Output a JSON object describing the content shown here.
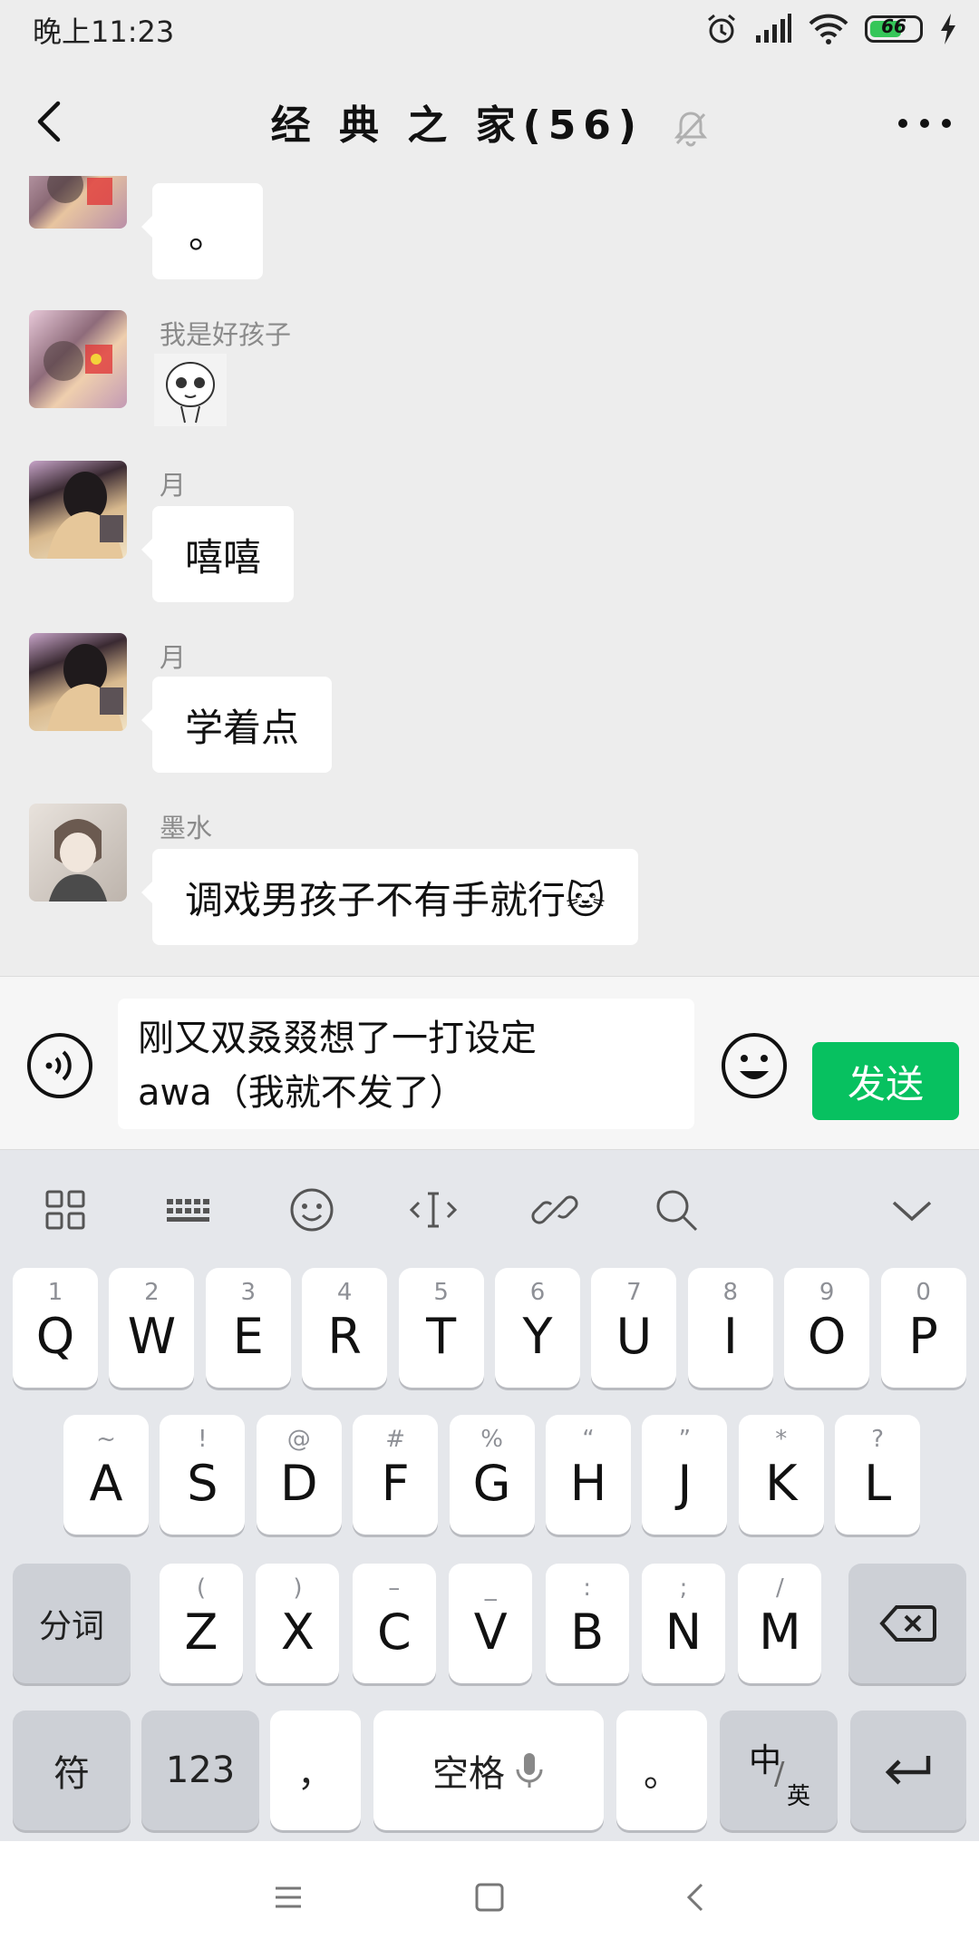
{
  "status_bar": {
    "time": "晚上11:23",
    "battery_level": "66",
    "battery_fraction": 0.66
  },
  "header": {
    "title": "经 典 之 家(56)"
  },
  "messages": [
    {
      "sender": "",
      "text": "。"
    },
    {
      "sender": "我是好孩子",
      "sticker": "face-sticker"
    },
    {
      "sender": "月",
      "text": "嘻嘻"
    },
    {
      "sender": "月",
      "text": "学着点"
    },
    {
      "sender": "墨水",
      "text": "调戏男孩子不有手就行🐱"
    }
  ],
  "composer": {
    "draft_line1": "刚又双叒叕想了一打设定",
    "draft_line2": "awa（我就不发了）",
    "send_label": "发送"
  },
  "keyboard": {
    "row1": [
      {
        "hint": "1",
        "key": "Q"
      },
      {
        "hint": "2",
        "key": "W"
      },
      {
        "hint": "3",
        "key": "E"
      },
      {
        "hint": "4",
        "key": "R"
      },
      {
        "hint": "5",
        "key": "T"
      },
      {
        "hint": "6",
        "key": "Y"
      },
      {
        "hint": "7",
        "key": "U"
      },
      {
        "hint": "8",
        "key": "I"
      },
      {
        "hint": "9",
        "key": "O"
      },
      {
        "hint": "0",
        "key": "P"
      }
    ],
    "row2": [
      {
        "hint": "~",
        "key": "A"
      },
      {
        "hint": "!",
        "key": "S"
      },
      {
        "hint": "@",
        "key": "D"
      },
      {
        "hint": "#",
        "key": "F"
      },
      {
        "hint": "%",
        "key": "G"
      },
      {
        "hint": "“",
        "key": "H"
      },
      {
        "hint": "”",
        "key": "J"
      },
      {
        "hint": "*",
        "key": "K"
      },
      {
        "hint": "?",
        "key": "L"
      }
    ],
    "row3": [
      {
        "hint": "(",
        "key": "Z"
      },
      {
        "hint": ")",
        "key": "X"
      },
      {
        "hint": "–",
        "key": "C"
      },
      {
        "hint": "_",
        "key": "V"
      },
      {
        "hint": ":",
        "key": "B"
      },
      {
        "hint": ";",
        "key": "N"
      },
      {
        "hint": "/",
        "key": "M"
      }
    ],
    "segment_label": "分词",
    "symbol_label": "符",
    "numbers_label": "123",
    "comma_label": "，",
    "space_label": "空格",
    "period_label": "。",
    "lang_top": "中",
    "lang_bottom": "英"
  },
  "colors": {
    "accent": "#07c160",
    "chat_bg": "#ededed",
    "bubble": "#ffffff"
  }
}
